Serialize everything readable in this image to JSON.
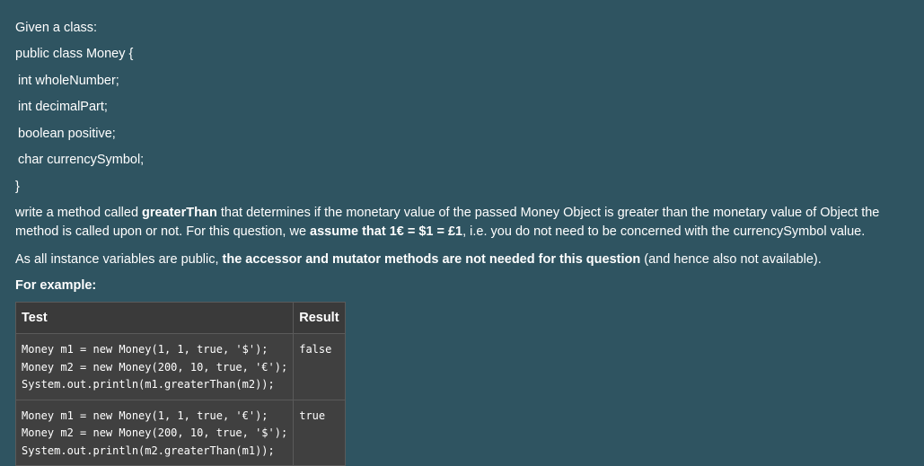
{
  "intro": "Given a class:",
  "class_code": [
    "public class Money {",
    "int wholeNumber;",
    "int decimalPart;",
    "boolean positive;",
    "char currencySymbol;",
    "}"
  ],
  "paragraph1": {
    "a": "write a method called ",
    "b_bold": "greaterThan",
    "c": " that determines if the monetary value of the passed Money Object is greater than the monetary value of Object the method is called upon or not. For this question, we ",
    "d_bold": "assume that 1€ = $1 = £1",
    "e": ", i.e. you do not need to be concerned with the currencySymbol value."
  },
  "paragraph2": {
    "a": "As all instance variables are public, ",
    "b_bold": "the accessor and mutator methods are not needed for this question",
    "c": " (and hence also not available)."
  },
  "example_heading": "For example:",
  "table": {
    "headers": [
      "Test",
      "Result"
    ],
    "rows": [
      {
        "test": "Money m1 = new Money(1, 1, true, '$');\nMoney m2 = new Money(200, 10, true, '€');\nSystem.out.println(m1.greaterThan(m2));",
        "result": "false"
      },
      {
        "test": "Money m1 = new Money(1, 1, true, '€');\nMoney m2 = new Money(200, 10, true, '$');\nSystem.out.println(m2.greaterThan(m1));",
        "result": "true"
      }
    ]
  }
}
